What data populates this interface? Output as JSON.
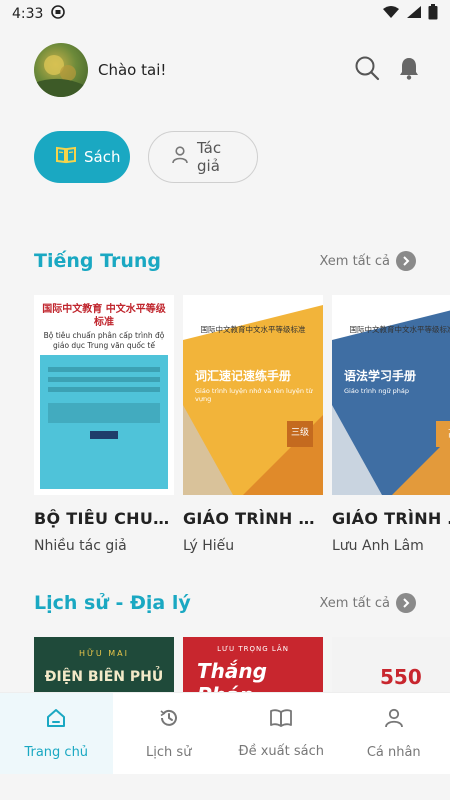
{
  "status_bar": {
    "time": "4:33"
  },
  "header": {
    "greeting": "Chào tai!"
  },
  "chips": [
    {
      "label": "Sách",
      "active": true
    },
    {
      "label": "Tác giả",
      "active": false
    }
  ],
  "sections": [
    {
      "title": "Tiếng Trung",
      "see_all": "Xem tất cả",
      "books": [
        {
          "title": "BỘ TIÊU CHUẨN NĂNG LỰC",
          "author": "Nhiều tác giả",
          "cover_heading": "国际中文教育 中文水平等级标准",
          "cover_sub": "Bộ tiêu chuẩn phân cấp trình độ giáo dục Trung văn quốc tế"
        },
        {
          "title": "GIÁO TRÌNH LUYỆN NHỚ",
          "author": "Lý Hiếu",
          "cover_heading": "词汇速记速练手册",
          "cover_sub": "Giáo trình luyện nhớ và rèn luyện từ vựng",
          "cover_level": "三级"
        },
        {
          "title": "GIÁO TRÌNH NGỮ PHÁP",
          "author": "Lưu Anh Lâm",
          "cover_heading": "语法学习手册",
          "cover_sub": "Giáo trình ngữ pháp",
          "cover_level": "高"
        }
      ]
    },
    {
      "title": "Lịch sử - Địa lý",
      "see_all": "Xem tất cả",
      "books": [
        {
          "cover_top": "HỮU MAI",
          "cover_heading": "ĐIỆN BIÊN PHỦ"
        },
        {
          "cover_top": "LƯU TRỌNG LÂN",
          "cover_heading": "Thắng Pháp"
        },
        {
          "cover_heading": "550"
        }
      ]
    }
  ],
  "bottom_nav": [
    {
      "label": "Trang chủ",
      "icon": "home-icon",
      "active": true
    },
    {
      "label": "Lịch sử",
      "icon": "history-icon",
      "active": false
    },
    {
      "label": "Đề xuất sách",
      "icon": "book-open-icon",
      "active": false
    },
    {
      "label": "Cá nhân",
      "icon": "person-icon",
      "active": false
    }
  ],
  "colors": {
    "accent": "#1aa8c2",
    "cover1_bg": "#4fc3d9",
    "cover2_bg": "#f2b43a",
    "cover3_bg": "#3f6ea3"
  }
}
